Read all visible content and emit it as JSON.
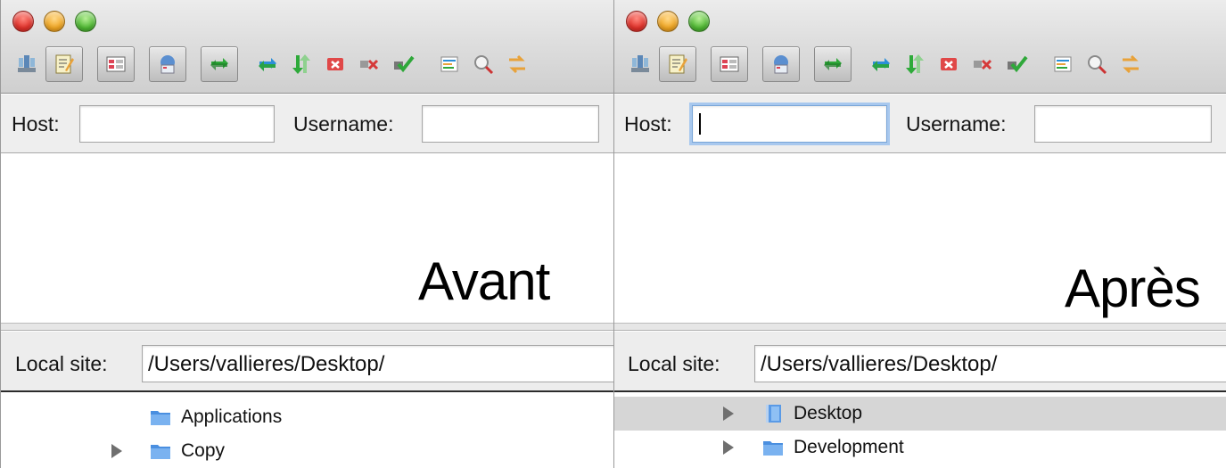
{
  "panels": [
    {
      "id": "before",
      "caption": "Avant",
      "quickconnect": {
        "host_label": "Host:",
        "host_value": "",
        "host_focused": false,
        "username_label": "Username:",
        "username_value": ""
      },
      "local": {
        "label": "Local site:",
        "path": "/Users/vallieres/Desktop/"
      },
      "tree": [
        {
          "label": "Applications",
          "expandable": false,
          "selected": false,
          "icon": "folder-icon"
        },
        {
          "label": "Copy",
          "expandable": true,
          "selected": false,
          "icon": "folder-icon"
        }
      ]
    },
    {
      "id": "after",
      "caption": "Après",
      "quickconnect": {
        "host_label": "Host:",
        "host_value": "",
        "host_focused": true,
        "username_label": "Username:",
        "username_value": ""
      },
      "local": {
        "label": "Local site:",
        "path": "/Users/vallieres/Desktop/"
      },
      "tree": [
        {
          "label": "Desktop",
          "expandable": true,
          "selected": true,
          "icon": "desktop-folder-icon"
        },
        {
          "label": "Development",
          "expandable": true,
          "selected": false,
          "icon": "folder-icon"
        }
      ]
    }
  ],
  "toolbar_icons": [
    "site-manager-icon",
    "message-log-icon",
    "local-tree-icon",
    "remote-tree-icon",
    "transfer-queue-icon",
    "refresh-icon",
    "process-queue-icon",
    "cancel-icon",
    "disconnect-icon",
    "reconnect-icon",
    "directory-listing-filters-icon",
    "search-remote-files-icon",
    "synchronized-browsing-icon"
  ],
  "colors": {
    "close": "#e0312a",
    "minimize": "#f0a623",
    "zoom": "#4fb833",
    "focus_ring": "#a8c8ee",
    "selection": "#d6d6d6"
  }
}
